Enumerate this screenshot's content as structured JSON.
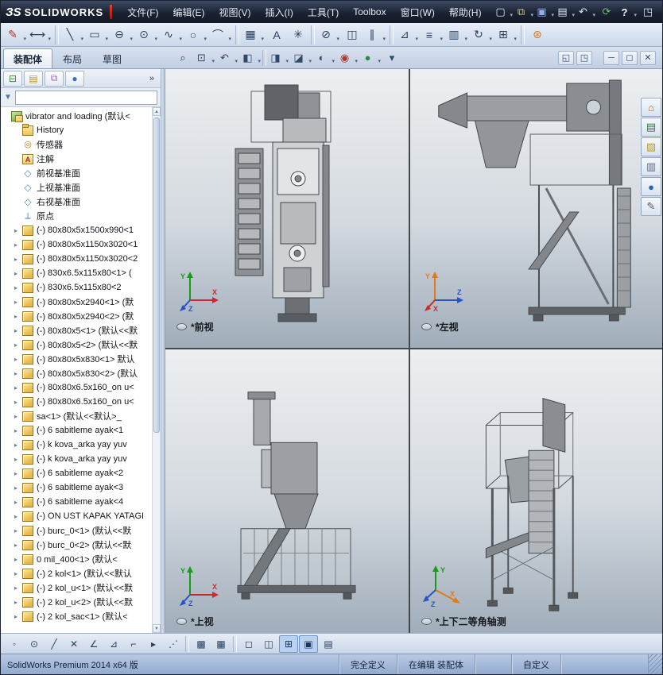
{
  "titlebar": {
    "logo_glyph": "ЗS",
    "logo_text": "SOLIDWORKS",
    "menus": [
      {
        "label": "文件(F)",
        "name": "menu-file"
      },
      {
        "label": "编辑(E)",
        "name": "menu-edit"
      },
      {
        "label": "视图(V)",
        "name": "menu-view"
      },
      {
        "label": "插入(I)",
        "name": "menu-insert"
      },
      {
        "label": "工具(T)",
        "name": "menu-tools"
      },
      {
        "label": "Toolbox",
        "name": "menu-toolbox"
      },
      {
        "label": "窗口(W)",
        "name": "menu-window"
      },
      {
        "label": "帮助(H)",
        "name": "menu-help"
      }
    ],
    "quick_icons": [
      {
        "g": "▢",
        "n": "new-document-icon",
        "cls": "dd",
        "ia": "true"
      },
      {
        "g": "⧉",
        "n": "open-document-icon",
        "cls": "dd",
        "ia": "true"
      },
      {
        "g": "▣",
        "n": "save-icon",
        "cls": "dd",
        "ia": "true"
      },
      {
        "g": "▤",
        "n": "print-icon",
        "cls": "dd",
        "ia": "true"
      },
      {
        "g": "↶",
        "n": "undo-icon",
        "cls": "dd",
        "ia": "true"
      },
      {
        "g": "⟳",
        "n": "rebuild-icon",
        "ia": "true"
      },
      {
        "g": "?",
        "n": "help-icon",
        "cls": "dd",
        "ia": "true"
      },
      {
        "g": "◳",
        "n": "toggle-fullscreen-icon",
        "ia": "true"
      }
    ]
  },
  "sketch_toolbar": {
    "icons": [
      {
        "g": "✎",
        "n": "sketch-icon",
        "cls": "dd",
        "ia": "true"
      },
      {
        "g": "⟷",
        "n": "smart-dimension-icon",
        "cls": "dd",
        "ia": "true"
      },
      {
        "g": "",
        "n": "separator",
        "cls": "sep",
        "ia": "false"
      },
      {
        "g": "╲",
        "n": "line-icon",
        "cls": "dd",
        "ia": "true"
      },
      {
        "g": "▭",
        "n": "corner-rectangle-icon",
        "cls": "dd",
        "ia": "true"
      },
      {
        "g": "⊖",
        "n": "straight-slot-icon",
        "cls": "dd",
        "ia": "true"
      },
      {
        "g": "⊙",
        "n": "circle-icon",
        "cls": "dd",
        "ia": "true"
      },
      {
        "g": "∿",
        "n": "spline-icon",
        "cls": "dd",
        "ia": "true"
      },
      {
        "g": "○",
        "n": "ellipse-icon",
        "cls": "dd",
        "ia": "true"
      },
      {
        "g": "⌒",
        "n": "arc-icon",
        "cls": "dd",
        "ia": "true"
      },
      {
        "g": "",
        "n": "separator",
        "cls": "sep",
        "ia": "false"
      },
      {
        "g": "▦",
        "n": "linear-sketch-pattern-icon",
        "cls": "dd",
        "ia": "true"
      },
      {
        "g": "A",
        "n": "text-icon",
        "ia": "true"
      },
      {
        "g": "✳",
        "n": "point-icon",
        "ia": "true"
      },
      {
        "g": "",
        "n": "separator",
        "cls": "sep",
        "ia": "false"
      },
      {
        "g": "⊘",
        "n": "trim-entities-icon",
        "cls": "dd",
        "ia": "true"
      },
      {
        "g": "◫",
        "n": "mirror-entities-icon",
        "ia": "true"
      },
      {
        "g": "∥",
        "n": "offset-entities-icon",
        "cls": "dd",
        "ia": "true"
      },
      {
        "g": "",
        "n": "separator",
        "cls": "sep",
        "ia": "false"
      },
      {
        "g": "⊿",
        "n": "chamfer-icon",
        "cls": "dd",
        "ia": "true"
      },
      {
        "g": "≡",
        "n": "align-icon",
        "cls": "dd",
        "ia": "true"
      },
      {
        "g": "▥",
        "n": "modify-sketch-icon",
        "cls": "dd",
        "ia": "true"
      },
      {
        "g": "↻",
        "n": "rotate-entities-icon",
        "cls": "dd",
        "ia": "true"
      },
      {
        "g": "⊞",
        "n": "grid-icon",
        "cls": "dd",
        "ia": "true"
      },
      {
        "g": "",
        "n": "separator",
        "cls": "sep",
        "ia": "false"
      },
      {
        "g": "⊛",
        "n": "xpress-tools-icon",
        "ia": "true"
      }
    ]
  },
  "tabs": {
    "items": [
      {
        "label": "装配体",
        "name": "tab-assembly",
        "cls": "active"
      },
      {
        "label": "布局",
        "name": "tab-layout"
      },
      {
        "label": "草图",
        "name": "tab-sketch"
      }
    ]
  },
  "headsup": {
    "icons": [
      {
        "g": "⌕",
        "n": "zoom-to-fit-icon",
        "ia": "true"
      },
      {
        "g": "⊡",
        "n": "zoom-to-area-icon",
        "cls": "dd",
        "ia": "true"
      },
      {
        "g": "↶",
        "n": "previous-view-icon",
        "cls": "dd",
        "ia": "true"
      },
      {
        "g": "◧",
        "n": "section-view-icon",
        "cls": "dd",
        "ia": "true"
      },
      {
        "g": "",
        "n": "separator",
        "cls": "sep",
        "ia": "false"
      },
      {
        "g": "◨",
        "n": "view-orientation-icon",
        "cls": "dd",
        "ia": "true"
      },
      {
        "g": "◪",
        "n": "display-style-icon",
        "cls": "dd",
        "ia": "true"
      },
      {
        "g": "◐",
        "n": "hide-show-items-icon",
        "cls": "dd",
        "ia": "true"
      },
      {
        "g": "◉",
        "n": "edit-appearance-icon",
        "cls": "dd",
        "ia": "true"
      },
      {
        "g": "●",
        "n": "apply-scene-icon",
        "cls": "dd",
        "ia": "true"
      },
      {
        "g": "▾",
        "n": "view-settings-icon",
        "ia": "true"
      }
    ],
    "window_icons": [
      {
        "g": "◱",
        "n": "tile-viewport-icon",
        "ia": "true"
      },
      {
        "g": "◳",
        "n": "maximize-viewport-icon",
        "ia": "true"
      },
      {
        "g": "",
        "n": "separator",
        "cls": "sep",
        "ia": "false"
      },
      {
        "g": "─",
        "n": "minimize-window-icon",
        "ia": "true"
      },
      {
        "g": "◻",
        "n": "restore-window-icon",
        "ia": "true"
      },
      {
        "g": "✕",
        "n": "close-window-icon",
        "ia": "true"
      }
    ]
  },
  "panel": {
    "tabs": [
      {
        "g": "⊟",
        "n": "featuremanager-tab-icon",
        "cls": "pm-feat",
        "ia": "true"
      },
      {
        "g": "▤",
        "n": "propertymanager-tab-icon",
        "cls": "pm-prop",
        "ia": "true"
      },
      {
        "g": "⧉",
        "n": "configurationmanager-tab-icon",
        "cls": "pm-conf",
        "ia": "true"
      },
      {
        "g": "●",
        "n": "displaymanager-tab-icon",
        "cls": "pm-disp",
        "ia": "true"
      }
    ],
    "expand_glyph": "»",
    "filter_glyph": "▼",
    "filter_value": ""
  },
  "tree": {
    "items": [
      {
        "label": "vibrator and loading (默认<",
        "icon": "ic-assembly",
        "arrow": "",
        "cls": "t-root"
      },
      {
        "label": "History",
        "icon": "ic-history",
        "arrow": ""
      },
      {
        "label": "传感器",
        "icon": "ic-sensors",
        "arrow": ""
      },
      {
        "label": "注解",
        "icon": "ic-annotations",
        "arrow": ""
      },
      {
        "label": "前视基准面",
        "icon": "ic-plane",
        "arrow": ""
      },
      {
        "label": "上视基准面",
        "icon": "ic-plane",
        "arrow": ""
      },
      {
        "label": "右视基准面",
        "icon": "ic-plane",
        "arrow": ""
      },
      {
        "label": "原点",
        "icon": "ic-origin",
        "arrow": ""
      },
      {
        "label": "(-) 80x80x5x1500x990<1",
        "icon": "ic-part",
        "arrow": "▸"
      },
      {
        "label": "(-) 80x80x5x1150x3020<1",
        "icon": "ic-part",
        "arrow": "▸"
      },
      {
        "label": "(-) 80x80x5x1150x3020<2",
        "icon": "ic-part",
        "arrow": "▸"
      },
      {
        "label": "(-) 830x6.5x115x80<1> (",
        "icon": "ic-part",
        "arrow": "▸"
      },
      {
        "label": "(-) 830x6.5x115x80<2",
        "icon": "ic-part",
        "arrow": "▸"
      },
      {
        "label": "(-) 80x80x5x2940<1> (默",
        "icon": "ic-part",
        "arrow": "▸"
      },
      {
        "label": "(-) 80x80x5x2940<2> (默",
        "icon": "ic-part",
        "arrow": "▸"
      },
      {
        "label": "(-) 80x80x5<1> (默认<<默",
        "icon": "ic-part",
        "arrow": "▸"
      },
      {
        "label": "(-) 80x80x5<2> (默认<<默",
        "icon": "ic-part",
        "arrow": "▸"
      },
      {
        "label": "(-) 80x80x5x830<1> 默认",
        "icon": "ic-part",
        "arrow": "▸"
      },
      {
        "label": "(-) 80x80x5x830<2> (默认",
        "icon": "ic-part",
        "arrow": "▸"
      },
      {
        "label": "(-) 80x80x6.5x160_on u<",
        "icon": "ic-part",
        "arrow": "▸"
      },
      {
        "label": "(-) 80x80x6.5x160_on u<",
        "icon": "ic-part",
        "arrow": "▸"
      },
      {
        "label": "sa<1> (默认<<默认>_",
        "icon": "ic-part",
        "arrow": "▸"
      },
      {
        "label": "(-) 6 sabitleme ayak<1",
        "icon": "ic-part",
        "arrow": "▸"
      },
      {
        "label": "(-) k kova_arka yay yuv",
        "icon": "ic-part",
        "arrow": "▸"
      },
      {
        "label": "(-) k kova_arka yay yuv",
        "icon": "ic-part",
        "arrow": "▸"
      },
      {
        "label": "(-) 6 sabitleme ayak<2",
        "icon": "ic-part",
        "arrow": "▸"
      },
      {
        "label": "(-) 6 sabitleme ayak<3",
        "icon": "ic-part",
        "arrow": "▸"
      },
      {
        "label": "(-) 6 sabitleme ayak<4",
        "icon": "ic-part",
        "arrow": "▸"
      },
      {
        "label": "(-) ON UST KAPAK YATAGI",
        "icon": "ic-part",
        "arrow": "▸"
      },
      {
        "label": "(-) burc_0<1> (默认<<默",
        "icon": "ic-part",
        "arrow": "▸"
      },
      {
        "label": "(-) burc_0<2> (默认<<默",
        "icon": "ic-part",
        "arrow": "▸"
      },
      {
        "label": "0 mil_400<1> (默认<",
        "icon": "ic-part",
        "arrow": "▸"
      },
      {
        "label": "(-) 2 kol<1> (默认<<默认",
        "icon": "ic-part",
        "arrow": "▸"
      },
      {
        "label": "(-) 2 kol_u<1> (默认<<默",
        "icon": "ic-part",
        "arrow": "▸"
      },
      {
        "label": "(-) 2 kol_u<2> (默认<<默",
        "icon": "ic-part",
        "arrow": "▸"
      },
      {
        "label": "(-) 2 kol_sac<1> (默认<",
        "icon": "ic-part",
        "arrow": "▸"
      }
    ]
  },
  "viewports": [
    {
      "label": "*前视",
      "triad": {
        "up": "Y",
        "right": "X",
        "diag": "Z"
      }
    },
    {
      "label": "*左视",
      "triad": {
        "up": "Y",
        "right": "Z",
        "diag": "X"
      }
    },
    {
      "label": "*上视",
      "triad": {
        "up": "Y",
        "right": "X",
        "diag": "Z"
      }
    },
    {
      "label": "*上下二等角轴测",
      "triad": {
        "up": "Y",
        "right": "X",
        "diag": "Z"
      }
    }
  ],
  "taskpane": {
    "icons": [
      {
        "g": "⌂",
        "n": "resources-icon",
        "cls": "tp-home",
        "ia": "true"
      },
      {
        "g": "▤",
        "n": "design-library-icon",
        "cls": "tp-lib",
        "ia": "true"
      },
      {
        "g": "▧",
        "n": "file-explorer-icon",
        "cls": "tp-folder",
        "ia": "true"
      },
      {
        "g": "▥",
        "n": "view-palette-icon",
        "cls": "tp-palette",
        "ia": "true"
      },
      {
        "g": "●",
        "n": "appearances-icon",
        "cls": "tp-sphere",
        "ia": "true"
      },
      {
        "g": "✎",
        "n": "custom-properties-icon",
        "cls": "tp-props",
        "ia": "true"
      }
    ]
  },
  "bottom_toolbar": {
    "icons": [
      {
        "g": "◦",
        "n": "select-icon",
        "ia": "true"
      },
      {
        "g": "⊙",
        "n": "circle-tool-icon",
        "ia": "true"
      },
      {
        "g": "╱",
        "n": "line-tool-icon",
        "ia": "true"
      },
      {
        "g": "✕",
        "n": "delete-icon",
        "ia": "true"
      },
      {
        "g": "∠",
        "n": "angle-tool-icon",
        "ia": "true"
      },
      {
        "g": "⊿",
        "n": "triangle-tool-icon",
        "ia": "true"
      },
      {
        "g": "⌐",
        "n": "corner-tool-icon",
        "ia": "true"
      },
      {
        "g": "▸",
        "n": "extend-icon",
        "ia": "true"
      },
      {
        "g": "⋰",
        "n": "spline-tool-icon",
        "ia": "true"
      },
      {
        "g": "",
        "n": "separator",
        "cls": "sep",
        "ia": "false"
      },
      {
        "g": "▩",
        "n": "grid-system-icon",
        "ia": "true"
      },
      {
        "g": "▦",
        "n": "pattern-icon",
        "ia": "true"
      },
      {
        "g": "",
        "n": "separator",
        "cls": "sep",
        "ia": "false"
      },
      {
        "g": "◻",
        "n": "single-view-icon",
        "ia": "true"
      },
      {
        "g": "◫",
        "n": "two-view-icon",
        "ia": "true"
      },
      {
        "g": "⊞",
        "n": "four-view-icon",
        "cls": "active",
        "ia": "true"
      },
      {
        "g": "▣",
        "n": "link-views-icon",
        "cls": "active",
        "ia": "true"
      },
      {
        "g": "▤",
        "n": "view-selector-icon",
        "ia": "true"
      }
    ]
  },
  "statusbar": {
    "app": "SolidWorks Premium 2014 x64 版",
    "fields": [
      {
        "label": "完全定义",
        "n": "definition-status",
        "ia": "false"
      },
      {
        "label": "在编辑 装配体",
        "n": "editing-mode-status",
        "ia": "false"
      },
      {
        "label": "",
        "n": "status-spacer",
        "ia": "false"
      },
      {
        "label": "自定义",
        "n": "customize-label",
        "ia": "true"
      }
    ]
  }
}
